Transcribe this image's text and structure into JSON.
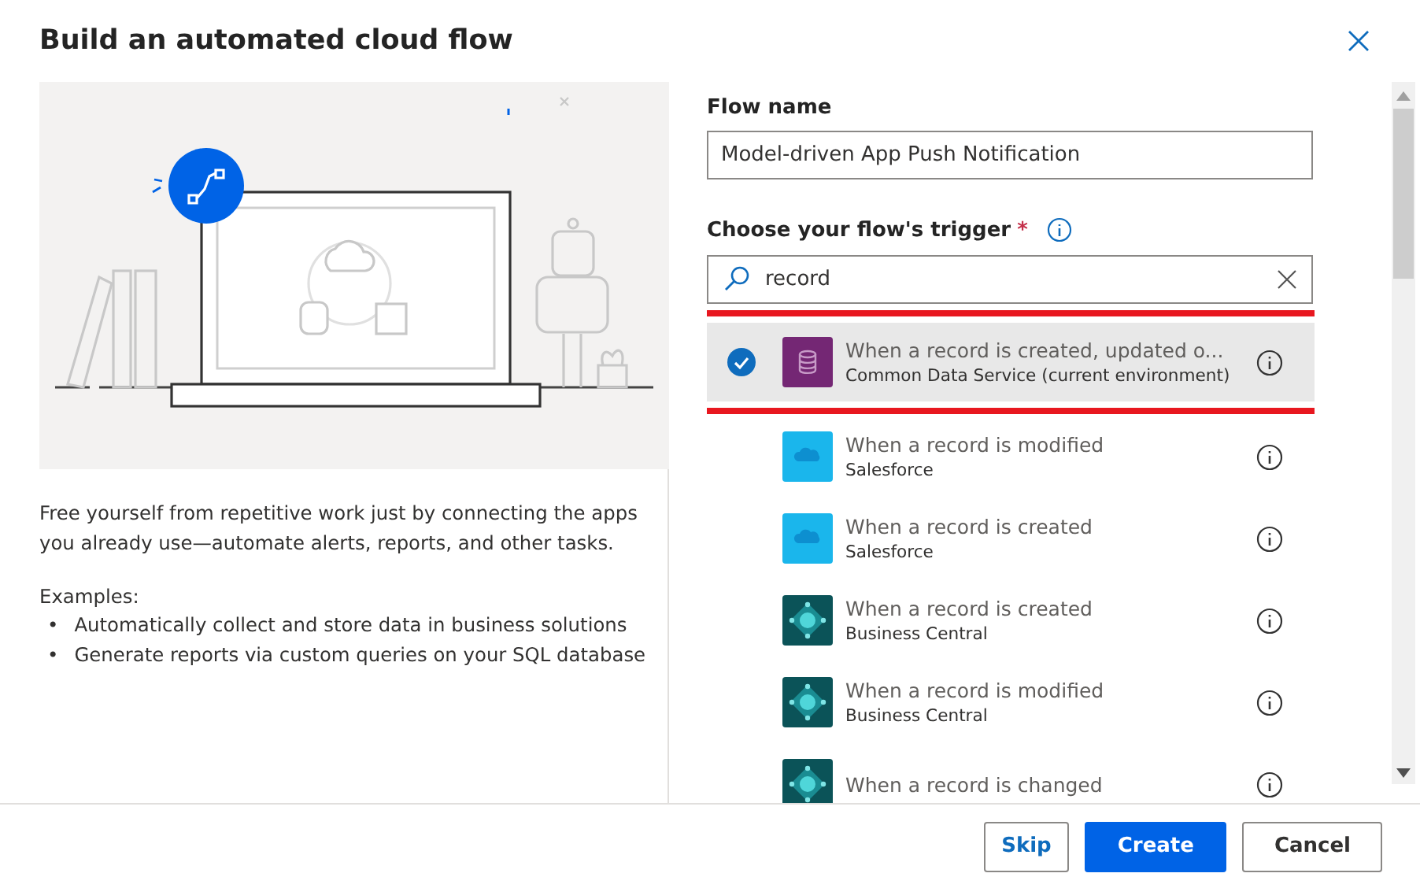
{
  "dialog": {
    "title": "Build an automated cloud flow"
  },
  "description": "Free yourself from repetitive work just by connecting the apps you already use—automate alerts, reports, and other tasks.",
  "examples_label": "Examples:",
  "examples": [
    {
      "marker": "•",
      "text": "Automatically collect and store data in business solutions"
    },
    {
      "marker": "•",
      "text": "Generate reports via custom queries on your SQL database"
    }
  ],
  "flow_name": {
    "label": "Flow name",
    "value": "Model-driven App Push Notification"
  },
  "trigger": {
    "label": "Choose your flow's trigger",
    "required_mark": "*",
    "search_value": "record"
  },
  "triggers": [
    {
      "title": "When a record is created, updated o...",
      "connector": "Common Data Service (current environment)",
      "kind": "dataverse",
      "selected": true,
      "highlighted": true
    },
    {
      "title": "When a record is modified",
      "connector": "Salesforce",
      "kind": "salesforce",
      "selected": false,
      "highlighted": false
    },
    {
      "title": "When a record is created",
      "connector": "Salesforce",
      "kind": "salesforce",
      "selected": false,
      "highlighted": false
    },
    {
      "title": "When a record is created",
      "connector": "Business Central",
      "kind": "business-central",
      "selected": false,
      "highlighted": false
    },
    {
      "title": "When a record is modified",
      "connector": "Business Central",
      "kind": "business-central",
      "selected": false,
      "highlighted": false
    },
    {
      "title": "When a record is changed",
      "kind": "business-central",
      "selected": false,
      "highlighted": false
    }
  ],
  "buttons": [
    {
      "label": "Skip",
      "kind": "outline"
    },
    {
      "label": "Create",
      "kind": "primary"
    },
    {
      "label": "Cancel",
      "kind": "default"
    }
  ]
}
